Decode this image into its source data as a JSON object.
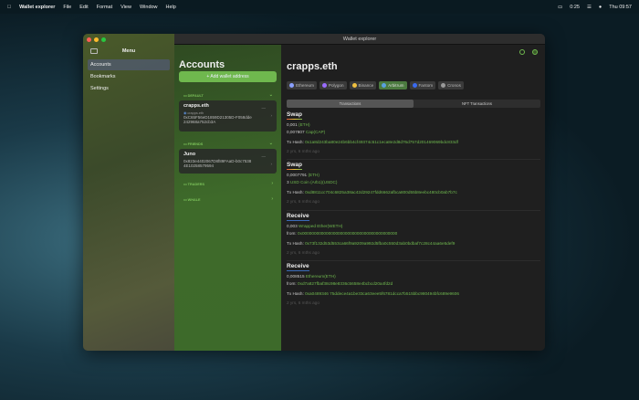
{
  "menubar": {
    "app": "Wallet explorer",
    "items": [
      "File",
      "Edit",
      "Format",
      "View",
      "Window",
      "Help"
    ],
    "battery": "0:25",
    "clock": "Thu 09:57"
  },
  "window": {
    "title": "Wallet explorer"
  },
  "sidebar": {
    "title": "Menu",
    "items": [
      "Accounts",
      "Bookmarks",
      "Settings"
    ]
  },
  "accounts": {
    "title": "Accounts",
    "add_label": "+ Add wallet address",
    "groups": [
      {
        "name": "DEFAULT"
      },
      {
        "name": "FRIENDS"
      },
      {
        "name": "TRADERS"
      },
      {
        "name": "WHALE"
      }
    ],
    "cards": [
      {
        "name": "crapps.eth",
        "ens": "crapps.eth",
        "address": "0xC65F56eD1859D21305D-F058dde242968a752cb3A"
      },
      {
        "name": "Juno",
        "address": "0x823e4402067D8f89FAaD-b0c75384E10258579594"
      }
    ]
  },
  "detail": {
    "title": "crapps.eth",
    "chains": [
      {
        "name": "Ethereum",
        "color": "#8aa0ff"
      },
      {
        "name": "Polygon",
        "color": "#9a6cff"
      },
      {
        "name": "Binance",
        "color": "#f0c040"
      },
      {
        "name": "Arbitrum",
        "color": "#5aa0e0"
      },
      {
        "name": "Fantom",
        "color": "#3a6af0"
      },
      {
        "name": "Cronos",
        "color": "#999999"
      }
    ],
    "tabs": [
      "Transactions",
      "NFT Transactions"
    ],
    "tx": [
      {
        "kind": "Swap",
        "l1v": "0,001",
        "l1t": "(ETH)",
        "l2v": "0,007807",
        "l2t": "Cap(CAP)",
        "hash_label": "Tx Hash:",
        "hash": "0x1a8d243ba80e24b6bb4cf49374c51c1eca8e2d8d76d757d201469069bdc833df",
        "ago": "2 yrs, 6 mths ago"
      },
      {
        "kind": "Swap",
        "l1v": "0,0007791",
        "l1t": "(ETH)",
        "l2v": "3",
        "l2t": "USD Coin (Arb1)(USDC)",
        "hash_label": "Tx Hash:",
        "hash": "0xd8811cc704c6825a38ac42d29247fdd6662afbca800d55b8eebc480cb0ab7b7c",
        "ago": "2 yrs, 6 mths ago"
      },
      {
        "kind": "Receive",
        "l1v": "0,003",
        "l1t": "Wrapped Ether(WETH)",
        "from_label": "from:",
        "from": "0x0000000000000000000000000000000000000000",
        "hash_label": "Tx Hash:",
        "hash": "0x73f132d53d553ca66f9a9209a992d5fba0c550d3ab0bdbaf7c28c44aa6e5def9",
        "ago": "2 yrs, 6 mths ago"
      },
      {
        "kind": "Receive",
        "l1v": "0,008515",
        "l1t": "Ethereum(ETH)",
        "from_label": "from:",
        "from": "0xd7a827fbaf38c98e8336c5658e4bcbcd20a4fd2d",
        "hash_label": "Tx Hash:",
        "hash": "0xa0489346 75ddece4a1be33ca63eee5f6781dcca7b515bbc980494bfc689e9606",
        "ago": "2 yrs, 6 mths ago"
      }
    ]
  }
}
